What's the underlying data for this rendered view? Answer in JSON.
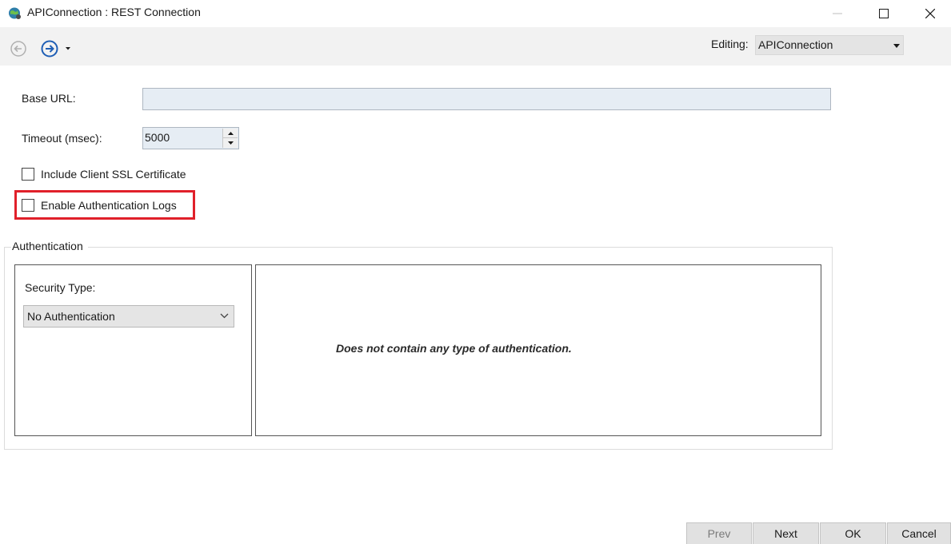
{
  "window": {
    "title": "APIConnection : REST Connection",
    "icon": "app-globe-icon"
  },
  "toolbar": {
    "editing_label": "Editing:",
    "editing_value": "APIConnection"
  },
  "form": {
    "base_url_label": "Base URL:",
    "base_url_value": "",
    "timeout_label": "Timeout (msec):",
    "timeout_value": "5000",
    "include_ssl_label": "Include Client SSL Certificate",
    "include_ssl_checked": false,
    "enable_auth_logs_label": "Enable Authentication Logs",
    "enable_auth_logs_checked": false
  },
  "authentication": {
    "group_title": "Authentication",
    "security_type_label": "Security Type:",
    "security_type_value": "No Authentication",
    "description": "Does not contain any type of authentication."
  },
  "buttons": {
    "prev": "Prev",
    "next": "Next",
    "ok": "OK",
    "cancel": "Cancel"
  },
  "colors": {
    "highlight": "#e0202a",
    "input_bg": "#e6edf4",
    "nav_forward": "#1f5fb5"
  }
}
